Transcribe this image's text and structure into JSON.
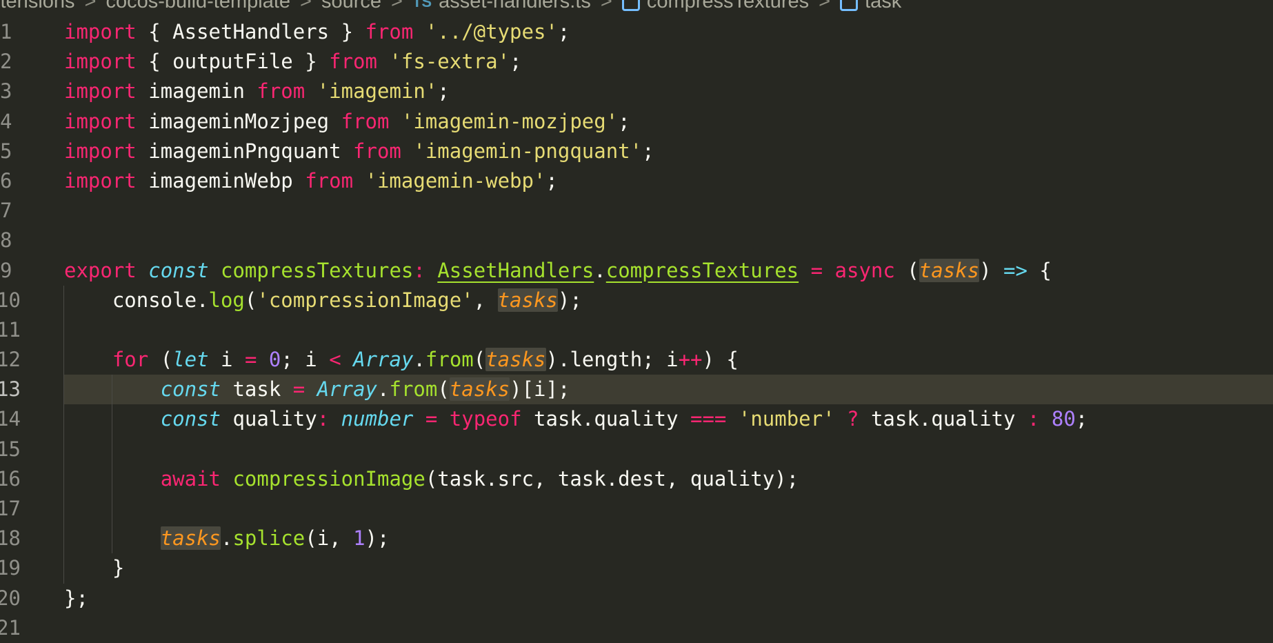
{
  "breadcrumb": {
    "items": [
      {
        "label": "xtensions",
        "icon": ""
      },
      {
        "label": "cocos-build-template",
        "icon": ""
      },
      {
        "label": "source",
        "icon": ""
      },
      {
        "label": "asset-handlers.ts",
        "icon": "ts-file-icon"
      },
      {
        "label": "compressTextures",
        "icon": "symbol-variable-icon"
      },
      {
        "label": "task",
        "icon": "symbol-variable-icon"
      }
    ],
    "separator": ">",
    "ts_label": "TS"
  },
  "editor": {
    "current_line": 13,
    "lines": [
      {
        "n": "1",
        "tokens": [
          [
            "kw",
            "import"
          ],
          [
            "",
            " { AssetHandlers } "
          ],
          [
            "kw",
            "from"
          ],
          [
            "",
            " "
          ],
          [
            "str",
            "'../@types'"
          ],
          [
            "",
            ";"
          ]
        ]
      },
      {
        "n": "2",
        "tokens": [
          [
            "kw",
            "import"
          ],
          [
            "",
            " { outputFile } "
          ],
          [
            "kw",
            "from"
          ],
          [
            "",
            " "
          ],
          [
            "str",
            "'fs-extra'"
          ],
          [
            "",
            ";"
          ]
        ]
      },
      {
        "n": "3",
        "tokens": [
          [
            "kw",
            "import"
          ],
          [
            "",
            " imagemin "
          ],
          [
            "kw",
            "from"
          ],
          [
            "",
            " "
          ],
          [
            "str",
            "'imagemin'"
          ],
          [
            "",
            ";"
          ]
        ]
      },
      {
        "n": "4",
        "tokens": [
          [
            "kw",
            "import"
          ],
          [
            "",
            " imageminMozjpeg "
          ],
          [
            "kw",
            "from"
          ],
          [
            "",
            " "
          ],
          [
            "str",
            "'imagemin-mozjpeg'"
          ],
          [
            "",
            ";"
          ]
        ]
      },
      {
        "n": "5",
        "tokens": [
          [
            "kw",
            "import"
          ],
          [
            "",
            " imageminPngquant "
          ],
          [
            "kw",
            "from"
          ],
          [
            "",
            " "
          ],
          [
            "str",
            "'imagemin-pngquant'"
          ],
          [
            "",
            ";"
          ]
        ]
      },
      {
        "n": "6",
        "tokens": [
          [
            "kw",
            "import"
          ],
          [
            "",
            " imageminWebp "
          ],
          [
            "kw",
            "from"
          ],
          [
            "",
            " "
          ],
          [
            "str",
            "'imagemin-webp'"
          ],
          [
            "",
            ";"
          ]
        ]
      },
      {
        "n": "7",
        "tokens": []
      },
      {
        "n": "8",
        "tokens": []
      },
      {
        "n": "9",
        "tokens": [
          [
            "kw",
            "export"
          ],
          [
            "",
            " "
          ],
          [
            "sto",
            "const"
          ],
          [
            "",
            " "
          ],
          [
            "fn",
            "compressTextures"
          ],
          [
            "op",
            ":"
          ],
          [
            "",
            " "
          ],
          [
            "fn ul",
            "AssetHandlers"
          ],
          [
            "",
            "."
          ],
          [
            "fn ul",
            "compressTextures"
          ],
          [
            "",
            " "
          ],
          [
            "op",
            "="
          ],
          [
            "",
            " "
          ],
          [
            "kw",
            "async"
          ],
          [
            "",
            " ("
          ],
          [
            "par hl",
            "tasks"
          ],
          [
            "",
            ") "
          ],
          [
            "arrow",
            "=>"
          ],
          [
            "",
            " {"
          ]
        ]
      },
      {
        "n": "10",
        "tokens": [
          [
            "",
            "    console."
          ],
          [
            "fn",
            "log"
          ],
          [
            "",
            "("
          ],
          [
            "str",
            "'compressionImage'"
          ],
          [
            "",
            ", "
          ],
          [
            "par hl",
            "tasks"
          ],
          [
            "",
            ");"
          ]
        ]
      },
      {
        "n": "11",
        "tokens": []
      },
      {
        "n": "12",
        "tokens": [
          [
            "",
            "    "
          ],
          [
            "kw",
            "for"
          ],
          [
            "",
            " ("
          ],
          [
            "sto",
            "let"
          ],
          [
            "",
            " i "
          ],
          [
            "op",
            "="
          ],
          [
            "",
            " "
          ],
          [
            "num",
            "0"
          ],
          [
            "",
            "; i "
          ],
          [
            "op",
            "<"
          ],
          [
            "",
            " "
          ],
          [
            "typ",
            "Array"
          ],
          [
            "",
            "."
          ],
          [
            "fn",
            "from"
          ],
          [
            "",
            "("
          ],
          [
            "par hl",
            "tasks"
          ],
          [
            "",
            ").length; i"
          ],
          [
            "op",
            "++"
          ],
          [
            "",
            ") {"
          ]
        ]
      },
      {
        "n": "13",
        "tokens": [
          [
            "",
            "        "
          ],
          [
            "sto",
            "const"
          ],
          [
            "",
            " task "
          ],
          [
            "op",
            "="
          ],
          [
            "",
            " "
          ],
          [
            "typ",
            "Array"
          ],
          [
            "",
            "."
          ],
          [
            "fn",
            "from"
          ],
          [
            "",
            "("
          ],
          [
            "par hl",
            "tasks"
          ],
          [
            "",
            ")[i];"
          ]
        ]
      },
      {
        "n": "14",
        "tokens": [
          [
            "",
            "        "
          ],
          [
            "sto",
            "const"
          ],
          [
            "",
            " quality"
          ],
          [
            "op",
            ":"
          ],
          [
            "",
            " "
          ],
          [
            "typ",
            "number"
          ],
          [
            "",
            " "
          ],
          [
            "op",
            "="
          ],
          [
            "",
            " "
          ],
          [
            "kw",
            "typeof"
          ],
          [
            "",
            " task.quality "
          ],
          [
            "op",
            "==="
          ],
          [
            "",
            " "
          ],
          [
            "str",
            "'number'"
          ],
          [
            "",
            " "
          ],
          [
            "op",
            "?"
          ],
          [
            "",
            " task.quality "
          ],
          [
            "op",
            ":"
          ],
          [
            "",
            " "
          ],
          [
            "num",
            "80"
          ],
          [
            "",
            ";"
          ]
        ]
      },
      {
        "n": "15",
        "tokens": []
      },
      {
        "n": "16",
        "tokens": [
          [
            "",
            "        "
          ],
          [
            "kw",
            "await"
          ],
          [
            "",
            " "
          ],
          [
            "fn",
            "compressionImage"
          ],
          [
            "",
            "(task.src, task.dest, quality);"
          ]
        ]
      },
      {
        "n": "17",
        "tokens": []
      },
      {
        "n": "18",
        "tokens": [
          [
            "",
            "        "
          ],
          [
            "par hl",
            "tasks"
          ],
          [
            "",
            "."
          ],
          [
            "fn",
            "splice"
          ],
          [
            "",
            "(i, "
          ],
          [
            "num",
            "1"
          ],
          [
            "",
            ");"
          ]
        ]
      },
      {
        "n": "19",
        "tokens": [
          [
            "",
            "    }"
          ]
        ]
      },
      {
        "n": "20",
        "tokens": [
          [
            "",
            "};"
          ]
        ]
      },
      {
        "n": "21",
        "tokens": []
      }
    ]
  }
}
